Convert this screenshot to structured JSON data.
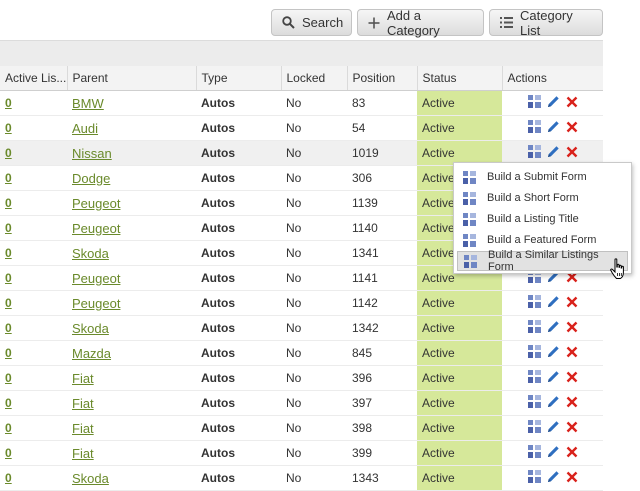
{
  "toolbar": {
    "search_label": "Search",
    "add_category_label": "Add a Category",
    "category_list_label": "Category List"
  },
  "table": {
    "headers": [
      "Active Lis...",
      "Parent",
      "Type",
      "Locked",
      "Position",
      "Status",
      "Actions"
    ],
    "rows": [
      {
        "id": "0",
        "parent": "BMW",
        "type": "Autos",
        "locked": "No",
        "position": "83",
        "status": "Active"
      },
      {
        "id": "0",
        "parent": "Audi",
        "type": "Autos",
        "locked": "No",
        "position": "54",
        "status": "Active"
      },
      {
        "id": "0",
        "parent": "Nissan",
        "type": "Autos",
        "locked": "No",
        "position": "1019",
        "status": "Active"
      },
      {
        "id": "0",
        "parent": "Dodge",
        "type": "Autos",
        "locked": "No",
        "position": "306",
        "status": "Active"
      },
      {
        "id": "0",
        "parent": "Peugeot",
        "type": "Autos",
        "locked": "No",
        "position": "1139",
        "status": "Active"
      },
      {
        "id": "0",
        "parent": "Peugeot",
        "type": "Autos",
        "locked": "No",
        "position": "1140",
        "status": "Active"
      },
      {
        "id": "0",
        "parent": "Skoda",
        "type": "Autos",
        "locked": "No",
        "position": "1341",
        "status": "Active"
      },
      {
        "id": "0",
        "parent": "Peugeot",
        "type": "Autos",
        "locked": "No",
        "position": "1141",
        "status": "Active"
      },
      {
        "id": "0",
        "parent": "Peugeot",
        "type": "Autos",
        "locked": "No",
        "position": "1142",
        "status": "Active"
      },
      {
        "id": "0",
        "parent": "Skoda",
        "type": "Autos",
        "locked": "No",
        "position": "1342",
        "status": "Active"
      },
      {
        "id": "0",
        "parent": "Mazda",
        "type": "Autos",
        "locked": "No",
        "position": "845",
        "status": "Active"
      },
      {
        "id": "0",
        "parent": "Fiat",
        "type": "Autos",
        "locked": "No",
        "position": "396",
        "status": "Active"
      },
      {
        "id": "0",
        "parent": "Fiat",
        "type": "Autos",
        "locked": "No",
        "position": "397",
        "status": "Active"
      },
      {
        "id": "0",
        "parent": "Fiat",
        "type": "Autos",
        "locked": "No",
        "position": "398",
        "status": "Active"
      },
      {
        "id": "0",
        "parent": "Fiat",
        "type": "Autos",
        "locked": "No",
        "position": "399",
        "status": "Active"
      },
      {
        "id": "0",
        "parent": "Skoda",
        "type": "Autos",
        "locked": "No",
        "position": "1343",
        "status": "Active"
      }
    ]
  },
  "menu": {
    "items": [
      "Build a Submit Form",
      "Build a Short Form",
      "Build a Listing Title",
      "Build a Featured Form",
      "Build a Similar Listings Form"
    ],
    "hovered_item": "Build a Similar Listings Form"
  },
  "icons": {
    "search": "search-icon",
    "add": "plus-icon",
    "list": "list-icon",
    "build": "build-form-icon",
    "edit": "pencil-icon",
    "delete": "delete-x-icon",
    "cursor": "hand-cursor-icon"
  },
  "colors": {
    "link": "#6a8a2b",
    "status_bg": "#d6e89a",
    "delete": "#d9211b",
    "edit": "#2f6fc0"
  }
}
